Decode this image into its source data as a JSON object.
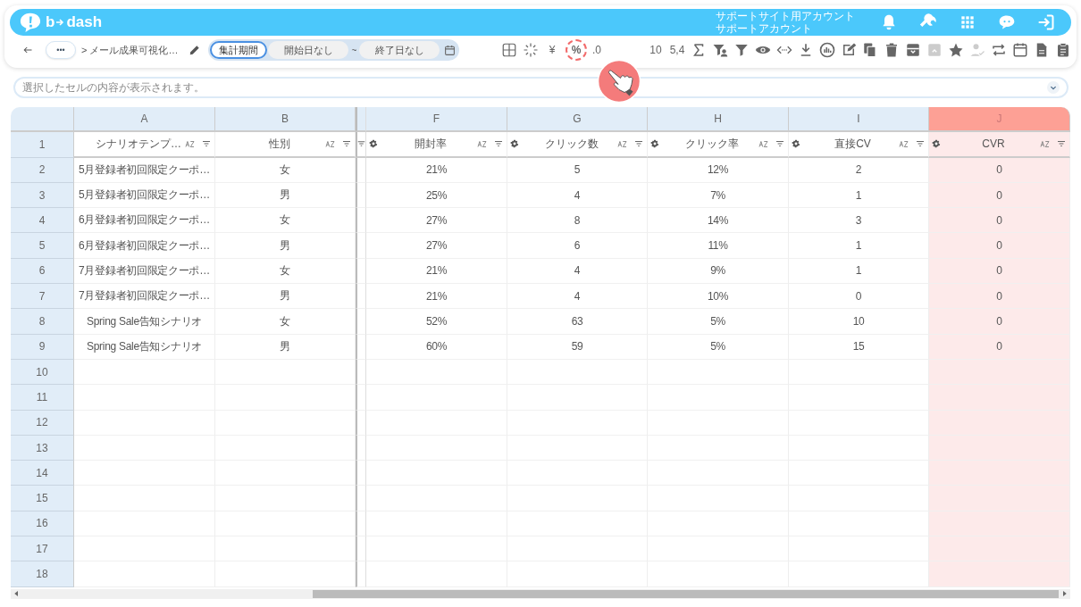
{
  "header": {
    "logo_left": "b",
    "logo_right": "dash",
    "account_lines": [
      "サポートサイト用アカウント",
      "サポートアカウント"
    ]
  },
  "nav": {
    "more": "•••",
    "breadcrumb": "> メール成果可視化…",
    "period_tabs": [
      {
        "label": "集計期間",
        "selected": true
      }
    ],
    "start": "開始日なし",
    "separator": "~",
    "end": "終了日なし"
  },
  "toolbar": [
    {
      "kind": "grid",
      "disabled": false
    },
    {
      "kind": "sparkle",
      "disabled": false
    },
    {
      "kind": "text",
      "label": "¥",
      "highlighted": false,
      "disabled": false
    },
    {
      "kind": "text",
      "label": "%",
      "highlighted": true,
      "disabled": false
    },
    {
      "kind": "text",
      "label": ".0",
      "highlighted": false,
      "disabled": false
    },
    {
      "kind": "text",
      "label": "10",
      "highlighted": false,
      "disabled": false
    },
    {
      "kind": "text",
      "label": "5,4",
      "highlighted": false,
      "disabled": false
    },
    {
      "kind": "sigma",
      "disabled": false
    },
    {
      "kind": "filter-person",
      "disabled": false
    },
    {
      "kind": "filter",
      "disabled": false
    },
    {
      "kind": "eye",
      "disabled": false
    },
    {
      "kind": "code",
      "disabled": false
    },
    {
      "kind": "download",
      "disabled": false
    },
    {
      "kind": "chart",
      "disabled": false
    },
    {
      "kind": "edit",
      "disabled": false
    },
    {
      "kind": "copy",
      "disabled": false
    },
    {
      "kind": "trash",
      "disabled": false
    },
    {
      "kind": "archive",
      "disabled": false
    },
    {
      "kind": "unarchive",
      "disabled": true
    },
    {
      "kind": "star",
      "disabled": false
    },
    {
      "kind": "person-check",
      "disabled": true
    },
    {
      "kind": "swap",
      "disabled": false
    },
    {
      "kind": "calendar",
      "disabled": false
    },
    {
      "kind": "document",
      "disabled": false
    },
    {
      "kind": "clipboard",
      "disabled": false
    }
  ],
  "formula_bar": {
    "placeholder": "選択したセルの内容が表示されます。"
  },
  "columns": [
    {
      "letter": "A",
      "name": "シナリオテンプ…",
      "kind": "text",
      "selected": false
    },
    {
      "letter": "B",
      "name": "性別",
      "kind": "text",
      "selected": false
    },
    {
      "letter": "F",
      "name": "開封率",
      "kind": "metric",
      "selected": false
    },
    {
      "letter": "G",
      "name": "クリック数",
      "kind": "metric",
      "selected": false
    },
    {
      "letter": "H",
      "name": "クリック率",
      "kind": "metric",
      "selected": false
    },
    {
      "letter": "I",
      "name": "直接CV",
      "kind": "metric",
      "selected": false
    },
    {
      "letter": "J",
      "name": "CVR",
      "kind": "metric",
      "selected": true
    }
  ],
  "header_row": "1",
  "rows": [
    {
      "num": "2",
      "cells": [
        "5月登録者初回限定クーポ…",
        "女",
        "21%",
        "5",
        "12%",
        "2",
        "0"
      ]
    },
    {
      "num": "3",
      "cells": [
        "5月登録者初回限定クーポ…",
        "男",
        "25%",
        "4",
        "7%",
        "1",
        "0"
      ]
    },
    {
      "num": "4",
      "cells": [
        "6月登録者初回限定クーポ…",
        "女",
        "27%",
        "8",
        "14%",
        "3",
        "0"
      ]
    },
    {
      "num": "5",
      "cells": [
        "6月登録者初回限定クーポ…",
        "男",
        "27%",
        "6",
        "11%",
        "1",
        "0"
      ]
    },
    {
      "num": "6",
      "cells": [
        "7月登録者初回限定クーポ…",
        "女",
        "21%",
        "4",
        "9%",
        "1",
        "0"
      ]
    },
    {
      "num": "7",
      "cells": [
        "7月登録者初回限定クーポ…",
        "男",
        "21%",
        "4",
        "10%",
        "0",
        "0"
      ]
    },
    {
      "num": "8",
      "cells": [
        "Spring Sale告知シナリオ",
        "女",
        "52%",
        "63",
        "5%",
        "10",
        "0"
      ]
    },
    {
      "num": "9",
      "cells": [
        "Spring Sale告知シナリオ",
        "男",
        "60%",
        "59",
        "5%",
        "15",
        "0"
      ]
    },
    {
      "num": "10",
      "cells": []
    },
    {
      "num": "11",
      "cells": []
    },
    {
      "num": "12",
      "cells": []
    },
    {
      "num": "13",
      "cells": []
    },
    {
      "num": "14",
      "cells": []
    },
    {
      "num": "15",
      "cells": []
    },
    {
      "num": "16",
      "cells": []
    },
    {
      "num": "17",
      "cells": []
    },
    {
      "num": "18",
      "cells": []
    }
  ]
}
